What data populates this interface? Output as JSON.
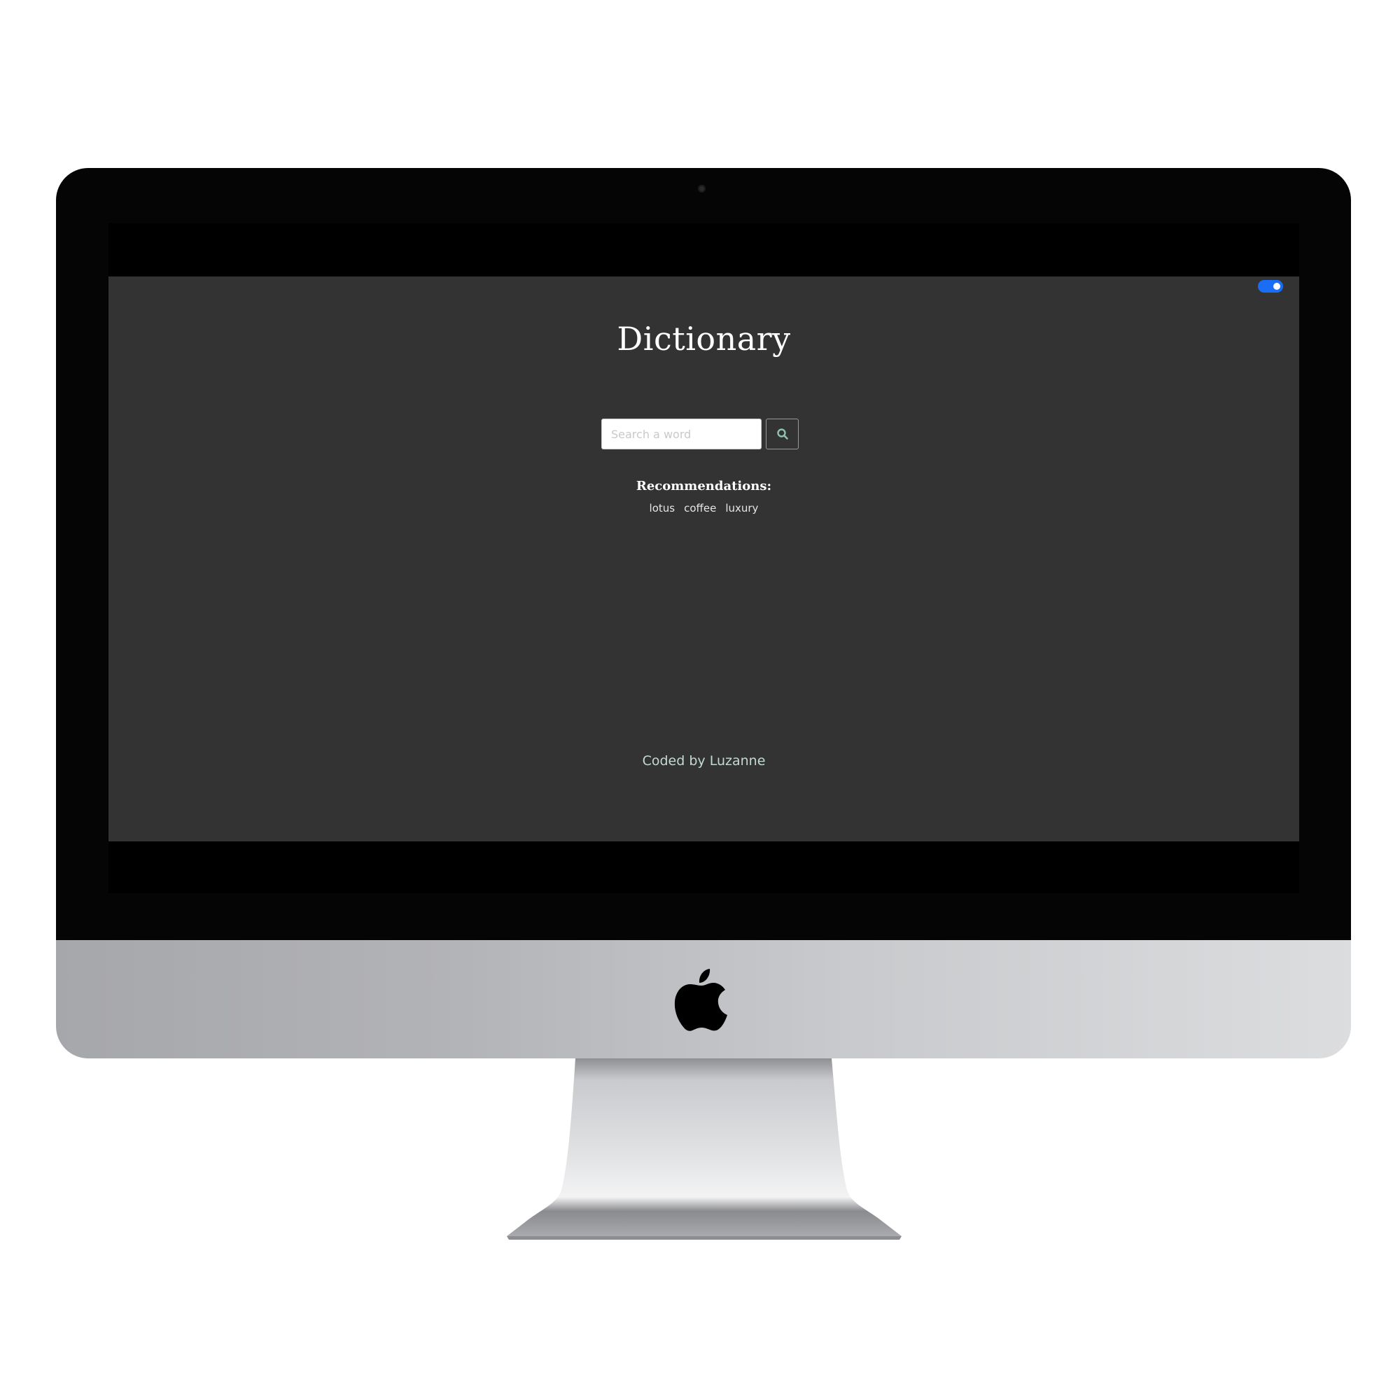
{
  "app": {
    "title": "Dictionary",
    "theme_toggle": {
      "state": "on",
      "color": "#1a6ef5"
    }
  },
  "search": {
    "placeholder": "Search a word",
    "value": "",
    "button_icon": "search-icon",
    "icon_color": "#8fc1ae"
  },
  "recommendations": {
    "label": "Recommendations:",
    "items": [
      "lotus",
      "coffee",
      "luxury"
    ]
  },
  "footer": {
    "text": "Coded by Luzanne"
  },
  "colors": {
    "app_background": "#333333",
    "title_text": "#ffffff",
    "footer_text": "#c2dbd2"
  },
  "device": {
    "logo": "apple-logo-icon"
  }
}
